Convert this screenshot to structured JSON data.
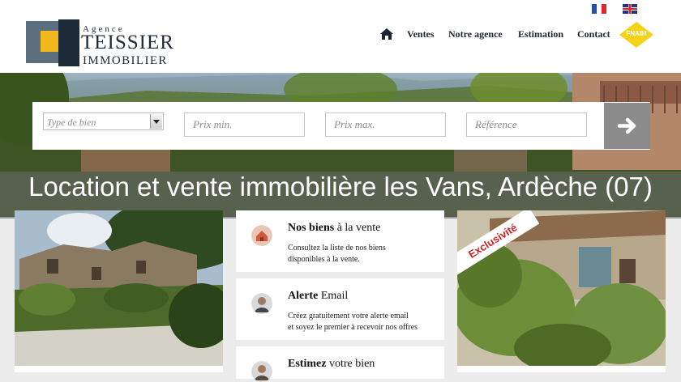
{
  "header": {
    "logo": {
      "agence": "Agence",
      "name": "TEISSIER",
      "subtitle": "IMMOBILIER"
    },
    "languages": [
      {
        "code": "fr",
        "icon": "flag-france-icon"
      },
      {
        "code": "en",
        "icon": "flag-uk-icon"
      }
    ],
    "nav": {
      "home_icon": "home-icon",
      "items": [
        "Ventes",
        "Notre agence",
        "Estimation",
        "Contact"
      ]
    },
    "badge": {
      "text": "FNAIM",
      "color": "#f5d21a"
    }
  },
  "search": {
    "type_placeholder": "Type de bien",
    "prix_min_placeholder": "Prix min.",
    "prix_max_placeholder": "Prix max.",
    "reference_placeholder": "Référence",
    "submit_icon": "arrow-right-icon"
  },
  "hero": {
    "title": "Location et vente immobilière les Vans, Ardèche (07)"
  },
  "cards": [
    {
      "title_bold": "Nos biens",
      "title_rest": " à la vente",
      "lines": [
        "Consultez la liste de nos biens",
        "disponibles à la vente."
      ],
      "icon": "house-thumbnail-icon"
    },
    {
      "title_bold": "Alerte",
      "title_rest": " Email",
      "lines": [
        "Créez gratuitement votre alerte email",
        "et soyez le premier à recevoir nos offres"
      ],
      "icon": "person-avatar-icon"
    },
    {
      "title_bold": "Estimez",
      "title_rest": " votre bien",
      "lines": [],
      "icon": "person-avatar-icon"
    }
  ],
  "featured": {
    "ribbon": "Exclusivité"
  },
  "colors": {
    "accent": "#f5d21a",
    "navy": "#1d2a38",
    "banner_overlay": "#696969",
    "search_button": "#8c8c8c"
  }
}
